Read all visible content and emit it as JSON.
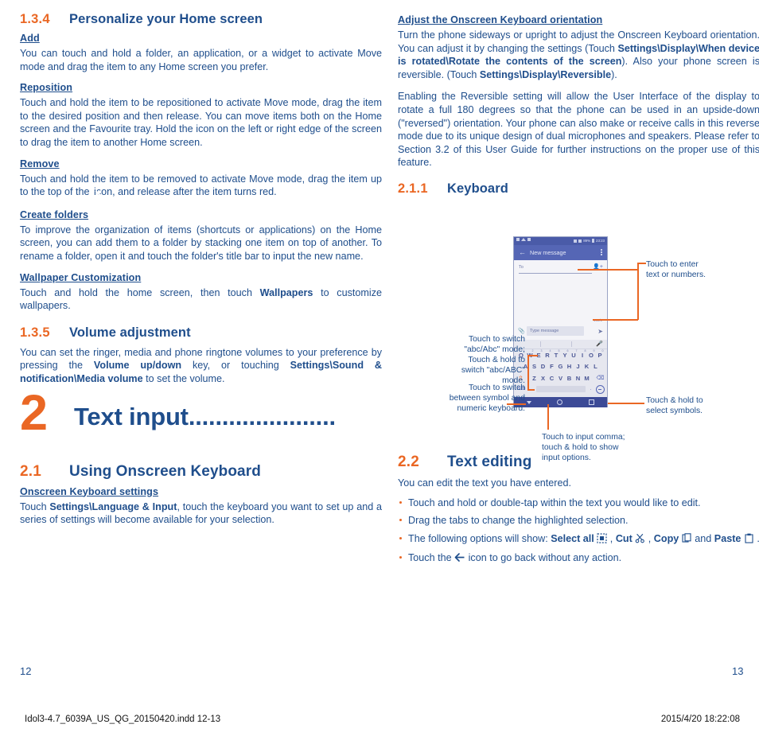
{
  "colors": {
    "accent_orange": "#ea6724",
    "text_navy": "#1f4e8c",
    "heading_navy": "#1f4e8c"
  },
  "left_column": {
    "section_134": {
      "number": "1.3.4",
      "title": "Personalize your Home screen",
      "blocks": [
        {
          "heading": "Add",
          "text": "You can touch and hold a folder, an application, or a widget to activate Move mode and drag the item to any Home screen you prefer."
        },
        {
          "heading": "Reposition ",
          "text": "Touch and hold the item to be repositioned to activate Move mode, drag the item to the desired position and then release. You can move items both on the Home screen and the Favourite tray. Hold the icon on the left or right edge of the screen to drag the item to another Home screen."
        },
        {
          "heading": "Remove",
          "text_before_icon": "Touch and hold the item to be removed to activate Move mode, drag the item up to the top of the ",
          "icon": "close-x-icon",
          "text_after_icon": " icon, and release after the item turns red."
        },
        {
          "heading": "Create folders",
          "text": "To improve the organization of items (shortcuts or applications) on the Home screen, you can add them to a folder by stacking one item on top of another. To rename a folder, open it and touch the folder's title bar to input the new name."
        },
        {
          "heading": "Wallpaper Customization",
          "text_before_bold": "Touch and hold the home screen, then touch ",
          "bold": "Wallpapers",
          "text_after_bold": " to customize wallpapers."
        }
      ]
    },
    "section_135": {
      "number": "1.3.5",
      "title": "Volume adjustment",
      "para_1": "You can set the ringer, media and phone ringtone volumes to your preference by pressing the ",
      "bold_1": "Volume up/down",
      "para_2": " key, or touching ",
      "bold_2": "Settings\\Sound & notification\\Media volume",
      "para_3": " to set the volume."
    },
    "chapter_2": {
      "number": "2",
      "title": "Text input",
      "dots": "......................"
    },
    "section_21": {
      "number": "2.1",
      "title": "Using Onscreen Keyboard",
      "sub_heading": "Onscreen Keyboard settings",
      "para_1": "Touch ",
      "bold_1": "Settings\\Language & Input",
      "para_2": ", touch the keyboard you want to set up and a series of settings will become available for your selection."
    },
    "page_number": "12"
  },
  "right_column": {
    "orientation_block": {
      "heading": "Adjust the Onscreen Keyboard orientation",
      "p1_a": "Turn the phone sideways or upright to adjust the Onscreen Keyboard orientation. You can adjust it by changing the settings (Touch ",
      "p1_b": "Settings\\Display\\When device is rotated\\Rotate the contents of the screen",
      "p1_c": "). Also your phone screen is reversible. (Touch ",
      "p1_d": "Settings\\Display\\Reversible",
      "p1_e": ").",
      "p2": "Enabling the Reversible setting will allow the User Interface of the display to rotate a full 180 degrees so that the phone can be used in an upside-down (\"reversed\") orientation. Your phone can also make or receive calls in this reverse mode due to its unique design of dual microphones and speakers. Please refer to Section 3.2 of this User Guide for further instructions on the proper use of this feature."
    },
    "section_211": {
      "number": "2.1.1",
      "title": "Keyboard"
    },
    "phone_mock": {
      "status_bar": {
        "battery_percent": "89%",
        "time": "23:23"
      },
      "app_bar": {
        "back_icon": "arrow-left-icon",
        "title": "New message",
        "overflow_icon": "more-vertical-icon"
      },
      "to_field_label": "To",
      "add_contact_icon": "add-contact-icon",
      "char_counter": "160/1",
      "attach_icon": "paperclip-icon",
      "message_input_placeholder": "Type message",
      "send_icon": "send-icon",
      "keyboard": {
        "mic_icon": "microphone-icon",
        "row1": [
          {
            "key": "Q",
            "sup": "1"
          },
          {
            "key": "W",
            "sup": "2"
          },
          {
            "key": "E",
            "sup": "3"
          },
          {
            "key": "R",
            "sup": "4"
          },
          {
            "key": "T",
            "sup": "5"
          },
          {
            "key": "Y",
            "sup": "6"
          },
          {
            "key": "U",
            "sup": "7"
          },
          {
            "key": "I",
            "sup": "8"
          },
          {
            "key": "O",
            "sup": "9"
          },
          {
            "key": "P",
            "sup": "0"
          }
        ],
        "row2": [
          "A",
          "S",
          "D",
          "F",
          "G",
          "H",
          "J",
          "K",
          "L"
        ],
        "row3_shift_icon": "shift-icon",
        "row3": [
          "Z",
          "X",
          "C",
          "V",
          "B",
          "N",
          "M"
        ],
        "row3_delete_icon": "backspace-icon",
        "row4_symbol_key": "?123",
        "row4_comma": ",",
        "row4_period": ".",
        "row4_emoji_icon": "emoji-icon"
      },
      "nav_bar": {
        "back_icon": "nav-back-icon",
        "home_icon": "nav-home-icon",
        "recents_icon": "nav-recents-icon"
      }
    },
    "callouts": [
      {
        "id": "enter-text",
        "text": "Touch to enter\ntext or numbers."
      },
      {
        "id": "abc-mode",
        "text": "Touch to switch\n\"abc/Abc\" mode;\nTouch & hold to\nswitch \"abc/ABC\"\nmode."
      },
      {
        "id": "symbol-numeric",
        "text": "Touch to switch\nbetween symbol and\nnumeric keyboard."
      },
      {
        "id": "select-symbols",
        "text": "Touch & hold to\nselect symbols."
      },
      {
        "id": "input-comma",
        "text": "Touch to input comma;\ntouch & hold to show\ninput options."
      }
    ],
    "section_22": {
      "number": "2.2",
      "title": "Text editing",
      "intro": "You can edit the text you have entered.",
      "bullets": [
        {
          "text": "Touch and hold or double-tap within the text you would like to edit."
        },
        {
          "text": "Drag the tabs to change the highlighted selection."
        },
        {
          "segments": [
            {
              "t": "The following options will show: ",
              "b": false
            },
            {
              "t": "Select all",
              "b": true
            },
            {
              "t": " ",
              "b": false
            },
            {
              "t": "ICON:select-all-icon",
              "b": false
            },
            {
              "t": " , ",
              "b": false
            },
            {
              "t": "Cut",
              "b": true
            },
            {
              "t": " ",
              "b": false
            },
            {
              "t": "ICON:scissors-icon",
              "b": false
            },
            {
              "t": " , ",
              "b": false
            },
            {
              "t": "Copy",
              "b": true
            },
            {
              "t": " ",
              "b": false
            },
            {
              "t": "ICON:copy-icon",
              "b": false
            },
            {
              "t": " and ",
              "b": false
            },
            {
              "t": "Paste",
              "b": true
            },
            {
              "t": " ",
              "b": false
            },
            {
              "t": "ICON:paste-icon",
              "b": false
            },
            {
              "t": " .",
              "b": false
            }
          ]
        },
        {
          "segments": [
            {
              "t": "Touch the ",
              "b": false
            },
            {
              "t": "ICON:arrow-left-icon",
              "b": false
            },
            {
              "t": " icon to go back without any action.",
              "b": false
            }
          ]
        }
      ]
    },
    "page_number": "13"
  },
  "footer": {
    "file_name": "Idol3-4.7_6039A_US_QG_20150420.indd   12-13",
    "timestamp": "2015/4/20   18:22:08"
  }
}
